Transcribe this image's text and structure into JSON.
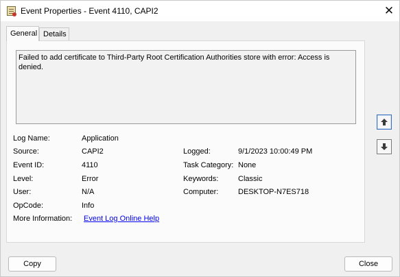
{
  "window": {
    "title": "Event Properties - Event 4110, CAPI2",
    "close_glyph": "✕"
  },
  "tabs": [
    {
      "label": "General",
      "active": true
    },
    {
      "label": "Details",
      "active": false
    }
  ],
  "message": "Failed to add certificate to Third-Party Root Certification Authorities store with error: Access is denied.",
  "fields": {
    "log_name": {
      "label": "Log Name:",
      "value": "Application"
    },
    "source": {
      "label": "Source:",
      "value": "CAPI2"
    },
    "event_id": {
      "label": "Event ID:",
      "value": "4110"
    },
    "level": {
      "label": "Level:",
      "value": "Error"
    },
    "user": {
      "label": "User:",
      "value": "N/A"
    },
    "opcode": {
      "label": "OpCode:",
      "value": "Info"
    },
    "more_info": {
      "label": "More Information:",
      "value": "Event Log Online Help"
    },
    "logged": {
      "label": "Logged:",
      "value": "9/1/2023 10:00:49 PM"
    },
    "task_category": {
      "label": "Task Category:",
      "value": "None"
    },
    "keywords": {
      "label": "Keywords:",
      "value": "Classic"
    },
    "computer": {
      "label": "Computer:",
      "value": "DESKTOP-N7ES718"
    }
  },
  "buttons": {
    "copy": "Copy",
    "close": "Close"
  },
  "icons": {
    "app": "event-viewer-icon",
    "scroll_up": "arrow-up-icon",
    "scroll_down": "arrow-down-icon"
  },
  "colors": {
    "link": "#0000ee",
    "focus_border": "#3a6fbf"
  }
}
